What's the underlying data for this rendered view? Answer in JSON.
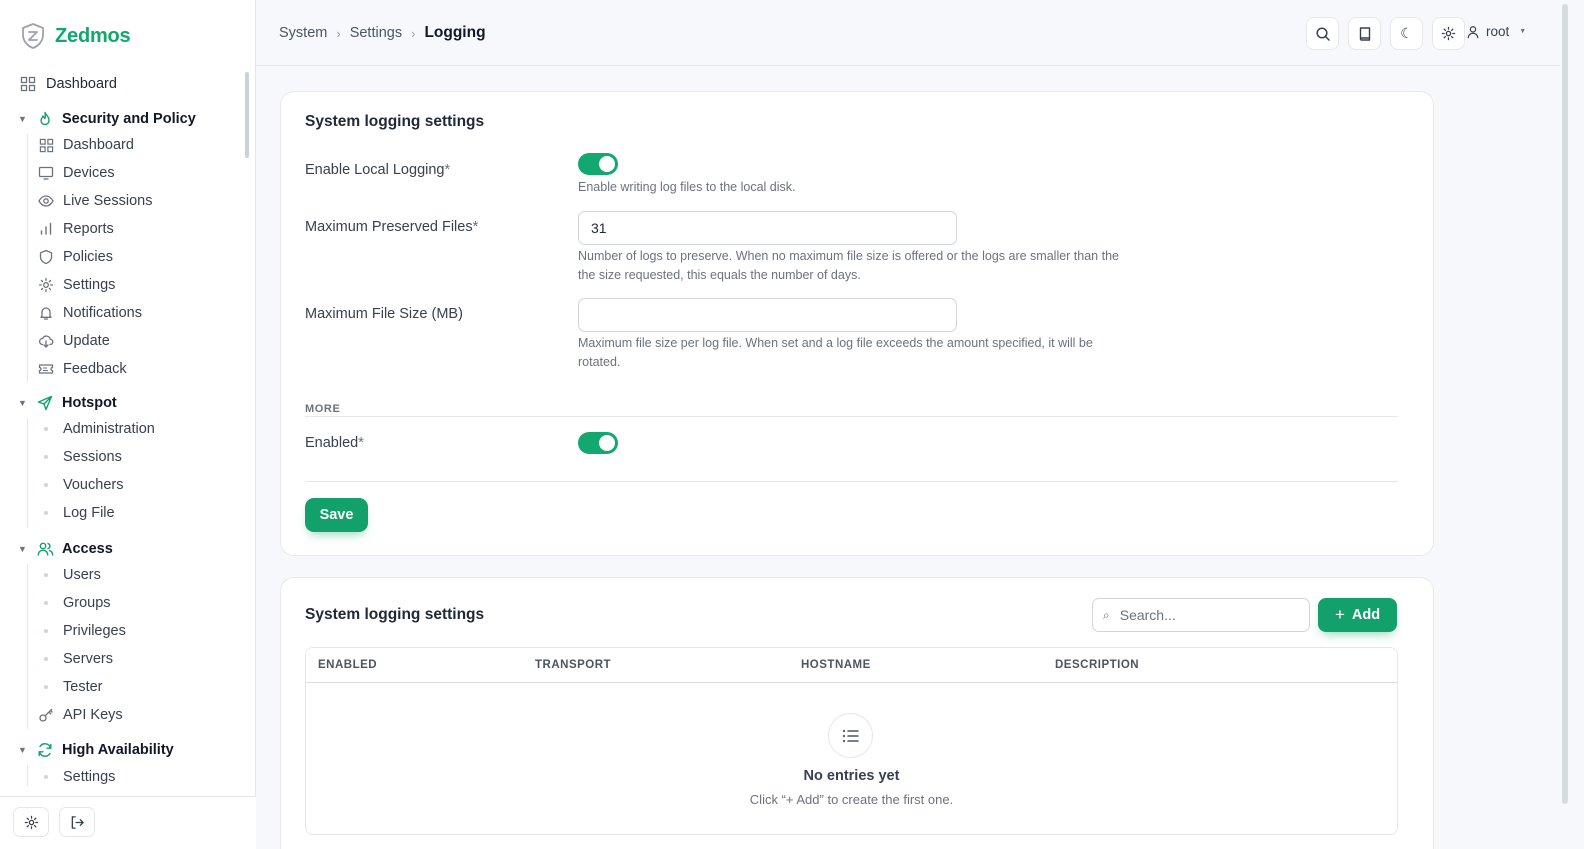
{
  "app": {
    "name": "Zedmos"
  },
  "sidebar": {
    "dashboard_label": "Dashboard",
    "groups": [
      {
        "label": "Security and Policy",
        "items": [
          "Dashboard",
          "Devices",
          "Live Sessions",
          "Reports",
          "Policies",
          "Settings",
          "Notifications",
          "Update",
          "Feedback"
        ]
      },
      {
        "label": "Hotspot",
        "items": [
          "Administration",
          "Sessions",
          "Vouchers",
          "Log File"
        ]
      },
      {
        "label": "Access",
        "items": [
          "Users",
          "Groups",
          "Privileges",
          "Servers",
          "Tester",
          "API Keys"
        ]
      },
      {
        "label": "High Availability",
        "items": [
          "Settings"
        ]
      }
    ]
  },
  "header": {
    "breadcrumb": [
      "System",
      "Settings",
      "Logging"
    ],
    "user": "root"
  },
  "form": {
    "title": "System logging settings",
    "enable_local_logging": {
      "label": "Enable Local Logging",
      "required_mark": "*",
      "value": true,
      "help": "Enable writing log files to the local disk."
    },
    "max_preserved_files": {
      "label": "Maximum Preserved Files",
      "required_mark": "*",
      "value": "31",
      "help": "Number of logs to preserve. When no maximum file size is offered or the logs are smaller than the the size requested, this equals the number of days."
    },
    "max_file_size": {
      "label": "Maximum File Size (MB)",
      "value": "",
      "help": "Maximum file size per log file. When set and a log file exceeds the amount specified, it will be rotated."
    },
    "more_section": "MORE",
    "enabled": {
      "label": "Enabled",
      "required_mark": "*",
      "value": true
    },
    "save_label": "Save"
  },
  "remote": {
    "title": "System logging settings",
    "search_placeholder": "Search...",
    "add_label": "Add",
    "columns": [
      "ENABLED",
      "TRANSPORT",
      "HOSTNAME",
      "DESCRIPTION"
    ],
    "rows": [],
    "empty_title": "No entries yet",
    "empty_subtitle": "Click “+ Add” to create the first one."
  },
  "colors": {
    "accent": "#12a06b",
    "brand": "#10a86b"
  }
}
